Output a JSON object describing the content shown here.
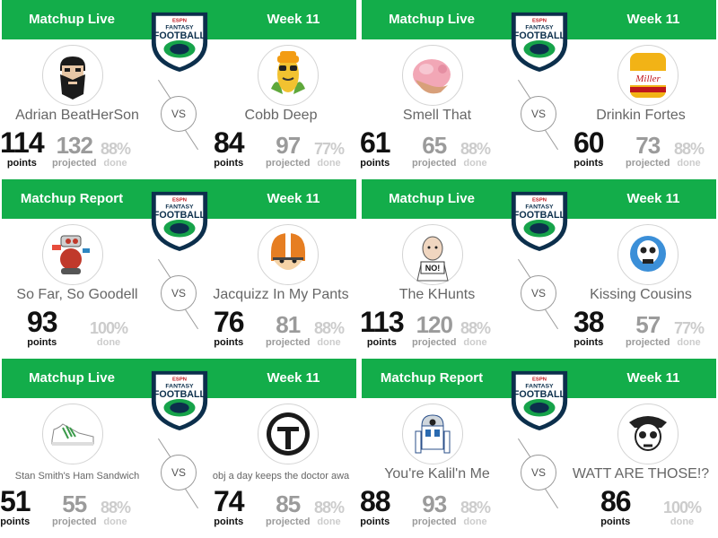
{
  "labels": {
    "points": "points",
    "projected": "projected",
    "done": "done",
    "vs": "VS"
  },
  "logo": {
    "line1": "ESPN",
    "line2": "FANTASY",
    "line3": "FOOTBALL"
  },
  "colors": {
    "banner": "#13ad4a",
    "logo_ring": "#0c2f4c",
    "logo_green": "#16a34a"
  },
  "matchups": [
    {
      "status": "Matchup Live",
      "week": "Week 11",
      "left": {
        "name": "Adrian BeatHerSon",
        "points": "114",
        "projected": "132",
        "done": "88%",
        "avatar": "bearded-man"
      },
      "right": {
        "name": "Cobb Deep",
        "points": "84",
        "projected": "97",
        "done": "77%",
        "avatar": "corn-cob"
      }
    },
    {
      "status": "Matchup Live",
      "week": "Week 11",
      "left": {
        "name": "Smell That",
        "points": "61",
        "projected": "65",
        "done": "88%",
        "avatar": "smell-hand"
      },
      "right": {
        "name": "Drinkin Fortes",
        "points": "60",
        "projected": "73",
        "done": "88%",
        "avatar": "miller-bottle"
      }
    },
    {
      "status": "Matchup Report",
      "week": "Week 11",
      "left": {
        "name": "So Far, So Goodell",
        "points": "93",
        "done": "100%",
        "avatar": "robot"
      },
      "right": {
        "name": "Jacquizz In My Pants",
        "points": "76",
        "projected": "81",
        "done": "88%",
        "avatar": "fox-helmet"
      }
    },
    {
      "status": "Matchup Live",
      "week": "Week 11",
      "left": {
        "name": "The KHunts",
        "points": "113",
        "projected": "120",
        "done": "88%",
        "avatar": "no-man",
        "avatar_text": "NO!"
      },
      "right": {
        "name": "Kissing Cousins",
        "points": "38",
        "projected": "57",
        "done": "77%",
        "avatar": "skull-blue"
      }
    },
    {
      "status": "Matchup Live",
      "week": "Week 11",
      "left": {
        "name": "Stan Smith's Ham Sandwich",
        "points": "51",
        "projected": "55",
        "done": "88%",
        "avatar": "sneaker"
      },
      "right": {
        "name": "obj a day keeps the doctor awa",
        "points": "74",
        "projected": "85",
        "done": "88%",
        "avatar": "gladiator-helmet"
      }
    },
    {
      "status": "Matchup Report",
      "week": "Week 11",
      "left": {
        "name": "You're Kalil'n Me",
        "points": "88",
        "projected": "93",
        "done": "88%",
        "avatar": "r2d2"
      },
      "right": {
        "name": "WATT ARE THOSE!?",
        "points": "86",
        "done": "100%",
        "avatar": "pirate-skull"
      }
    }
  ]
}
